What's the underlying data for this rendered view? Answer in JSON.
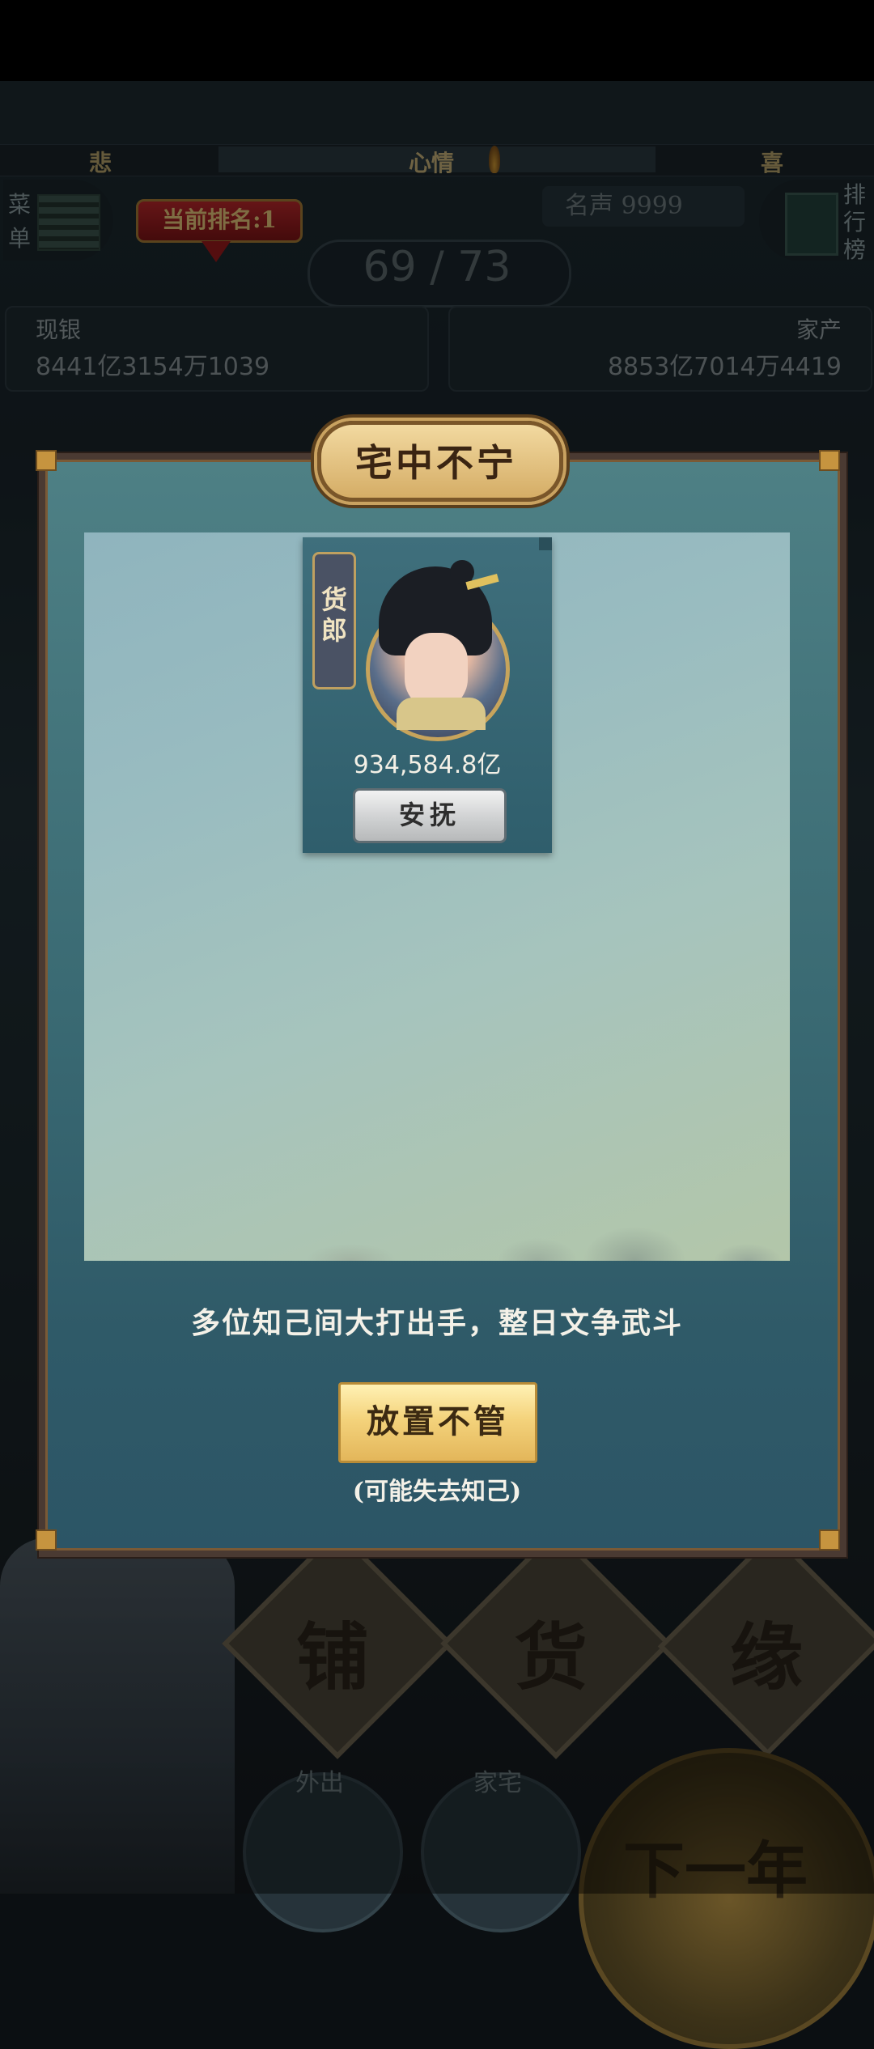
{
  "hud": {
    "mood": {
      "sad": "悲",
      "title": "心情",
      "happy": "喜"
    },
    "menu_label": "菜单",
    "rank_badge": "当前排名:1",
    "fame": "名声 9999",
    "ranklist_label": "排行榜",
    "progress": "69 / 73",
    "cash": {
      "label": "现银",
      "value": "8441亿3154万1039"
    },
    "assets": {
      "label": "家产",
      "value": "8853亿7014万4419"
    }
  },
  "bottom_nav": {
    "tiles": [
      "铺",
      "货",
      "缘"
    ],
    "outing": "外出",
    "home": "家宅",
    "next_year": "下一年"
  },
  "modal": {
    "title": "宅中不宁",
    "card": {
      "role": "货郎",
      "wealth": "934,584.8亿",
      "soothe_label": "安抚"
    },
    "message": "多位知己间大打出手，整日文争武斗",
    "ignore_label": "放置不管",
    "ignore_note": "(可能失去知己)"
  },
  "colors": {
    "modal_bg": "#3a6a73",
    "gold_button": "#f4d37c",
    "title_plate": "#e6c48a",
    "frame": "#4a3a32"
  }
}
